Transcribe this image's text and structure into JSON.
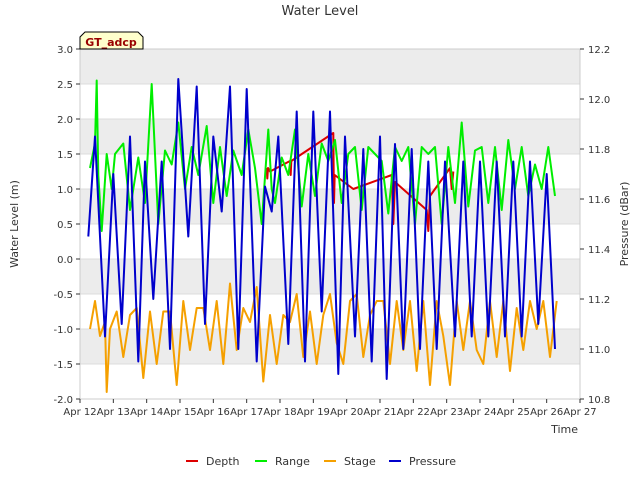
{
  "chart_data": {
    "type": "line",
    "title": "Water Level",
    "badge": "GT_adcp",
    "xlabel": "Time",
    "ylabel": "Water Level (m)",
    "ylabel_right": "Pressure (dBar)",
    "ylim": [
      -2.0,
      3.0
    ],
    "ylim_right": [
      10.8,
      12.2
    ],
    "yticks": [
      "-2.0",
      "-1.5",
      "-1.0",
      "-0.5",
      "0.0",
      "0.5",
      "1.0",
      "1.5",
      "2.0",
      "2.5",
      "3.0"
    ],
    "yticks_right": [
      "10.8",
      "11.0",
      "11.2",
      "11.4",
      "11.6",
      "11.8",
      "12.0",
      "12.2"
    ],
    "x_ticks": [
      "Apr 12",
      "Apr 13",
      "Apr 14",
      "Apr 15",
      "Apr 16",
      "Apr 17",
      "Apr 18",
      "Apr 19",
      "Apr 20",
      "Apr 21",
      "Apr 22",
      "Apr 23",
      "Apr 24",
      "Apr 25",
      "Apr 26",
      "Apr 27"
    ],
    "xlim": [
      12,
      27
    ],
    "grid": true,
    "legend_position": "bottom-center",
    "series": [
      {
        "name": "Depth",
        "color": "#dd0000",
        "axis": "left",
        "x": [
          17.6,
          17.62,
          17.64,
          17.7,
          18.3,
          18.32,
          18.34,
          19.6,
          19.62,
          19.64,
          20.2,
          21.35,
          21.4,
          21.45,
          22.4,
          22.45,
          22.5,
          23.1,
          23.15,
          23.2
        ],
        "y": [
          1.3,
          1.15,
          1.3,
          1.25,
          1.4,
          1.2,
          1.4,
          1.8,
          0.8,
          1.2,
          1.0,
          1.2,
          0.5,
          1.1,
          0.7,
          0.4,
          0.9,
          1.3,
          1.0,
          1.25
        ]
      },
      {
        "name": "Range",
        "color": "#00ee00",
        "axis": "left",
        "x": [
          12.3,
          12.45,
          12.5,
          12.55,
          12.65,
          12.8,
          12.95,
          13.05,
          13.3,
          13.5,
          13.75,
          13.95,
          14.15,
          14.35,
          14.55,
          14.75,
          14.95,
          15.15,
          15.35,
          15.55,
          15.8,
          16.0,
          16.2,
          16.4,
          16.6,
          16.85,
          17.05,
          17.25,
          17.45,
          17.65,
          17.75,
          17.85,
          18.05,
          18.25,
          18.45,
          18.65,
          18.85,
          19.05,
          19.25,
          19.45,
          19.65,
          19.85,
          20.05,
          20.25,
          20.45,
          20.65,
          20.85,
          21.05,
          21.25,
          21.45,
          21.65,
          21.85,
          22.05,
          22.25,
          22.45,
          22.65,
          22.85,
          23.05,
          23.25,
          23.45,
          23.65,
          23.85,
          24.05,
          24.25,
          24.45,
          24.65,
          24.85,
          25.05,
          25.25,
          25.45,
          25.65,
          25.85,
          26.05,
          26.25
        ],
        "y": [
          1.3,
          1.65,
          2.55,
          1.2,
          0.4,
          1.5,
          1.0,
          1.5,
          1.65,
          0.7,
          1.45,
          0.8,
          2.5,
          0.5,
          1.55,
          1.35,
          1.95,
          1.0,
          1.6,
          1.2,
          1.9,
          0.8,
          1.6,
          0.9,
          1.55,
          1.2,
          1.85,
          1.3,
          0.5,
          1.85,
          1.0,
          0.8,
          1.45,
          1.2,
          1.85,
          0.75,
          1.5,
          0.9,
          1.65,
          1.4,
          1.7,
          0.8,
          1.5,
          1.6,
          0.7,
          1.6,
          1.5,
          1.4,
          0.65,
          1.6,
          1.4,
          1.6,
          0.5,
          1.6,
          1.5,
          1.6,
          0.5,
          1.6,
          0.8,
          1.95,
          0.75,
          1.55,
          1.6,
          0.8,
          1.6,
          0.7,
          1.7,
          1.0,
          1.6,
          0.9,
          1.35,
          1.0,
          1.6,
          0.9
        ]
      },
      {
        "name": "Stage",
        "color": "#f5a000",
        "axis": "left",
        "x": [
          12.3,
          12.45,
          12.6,
          12.75,
          12.8,
          12.9,
          13.1,
          13.3,
          13.5,
          13.7,
          13.9,
          14.1,
          14.3,
          14.5,
          14.7,
          14.9,
          15.1,
          15.3,
          15.5,
          15.7,
          15.9,
          16.1,
          16.3,
          16.5,
          16.7,
          16.9,
          17.1,
          17.3,
          17.5,
          17.7,
          17.9,
          18.1,
          18.3,
          18.5,
          18.7,
          18.9,
          19.1,
          19.3,
          19.5,
          19.7,
          19.9,
          20.1,
          20.3,
          20.5,
          20.7,
          20.9,
          21.1,
          21.3,
          21.5,
          21.7,
          21.9,
          22.1,
          22.3,
          22.5,
          22.7,
          22.9,
          23.1,
          23.3,
          23.5,
          23.7,
          23.9,
          24.1,
          24.3,
          24.5,
          24.7,
          24.9,
          25.1,
          25.3,
          25.5,
          25.7,
          25.9,
          26.1,
          26.3
        ],
        "y": [
          -1.0,
          -0.6,
          -1.1,
          -0.9,
          -1.9,
          -1.0,
          -0.75,
          -1.4,
          -0.8,
          -0.7,
          -1.7,
          -0.75,
          -1.5,
          -0.75,
          -0.75,
          -1.8,
          -0.6,
          -1.3,
          -0.7,
          -0.7,
          -1.3,
          -0.6,
          -1.5,
          -0.35,
          -1.3,
          -0.7,
          -0.9,
          -0.4,
          -1.75,
          -0.8,
          -1.5,
          -0.8,
          -0.9,
          -0.5,
          -1.4,
          -0.75,
          -1.5,
          -0.8,
          -0.5,
          -1.2,
          -1.5,
          -0.6,
          -0.5,
          -1.4,
          -0.8,
          -0.6,
          -0.6,
          -1.5,
          -0.6,
          -1.3,
          -0.6,
          -1.6,
          -0.6,
          -1.8,
          -0.6,
          -1.1,
          -1.8,
          -0.6,
          -1.3,
          -0.6,
          -1.3,
          -1.5,
          -0.6,
          -1.4,
          -0.6,
          -1.6,
          -0.7,
          -1.3,
          -0.6,
          -1.0,
          -0.6,
          -1.4,
          -0.6
        ]
      },
      {
        "name": "Pressure",
        "color": "#0000cc",
        "axis": "right",
        "x": [
          12.25,
          12.45,
          12.75,
          13.0,
          13.25,
          13.5,
          13.75,
          13.95,
          14.2,
          14.45,
          14.7,
          14.95,
          15.25,
          15.5,
          15.75,
          16.0,
          16.25,
          16.5,
          16.75,
          17.0,
          17.3,
          17.55,
          17.75,
          17.95,
          18.25,
          18.5,
          18.75,
          19.0,
          19.25,
          19.5,
          19.75,
          19.95,
          20.25,
          20.5,
          20.75,
          21.0,
          21.2,
          21.45,
          21.7,
          21.95,
          22.2,
          22.45,
          22.7,
          22.95,
          23.25,
          23.5,
          23.75,
          24.0,
          24.25,
          24.5,
          24.75,
          25.0,
          25.25,
          25.5,
          25.75,
          26.0,
          26.25
        ],
        "y": [
          11.45,
          11.85,
          11.05,
          11.7,
          11.1,
          11.85,
          10.95,
          11.75,
          11.2,
          11.75,
          11.0,
          12.08,
          11.45,
          12.05,
          11.1,
          11.85,
          11.55,
          12.05,
          11.0,
          12.04,
          10.95,
          11.65,
          11.55,
          11.85,
          11.02,
          11.95,
          10.95,
          11.95,
          11.15,
          11.95,
          10.9,
          11.85,
          11.05,
          11.8,
          10.95,
          11.85,
          10.88,
          11.82,
          11.0,
          11.8,
          11.0,
          11.75,
          11.0,
          11.75,
          11.05,
          11.75,
          11.05,
          11.75,
          11.05,
          11.75,
          11.05,
          11.75,
          11.05,
          11.75,
          11.1,
          11.7,
          11.0
        ]
      }
    ]
  }
}
